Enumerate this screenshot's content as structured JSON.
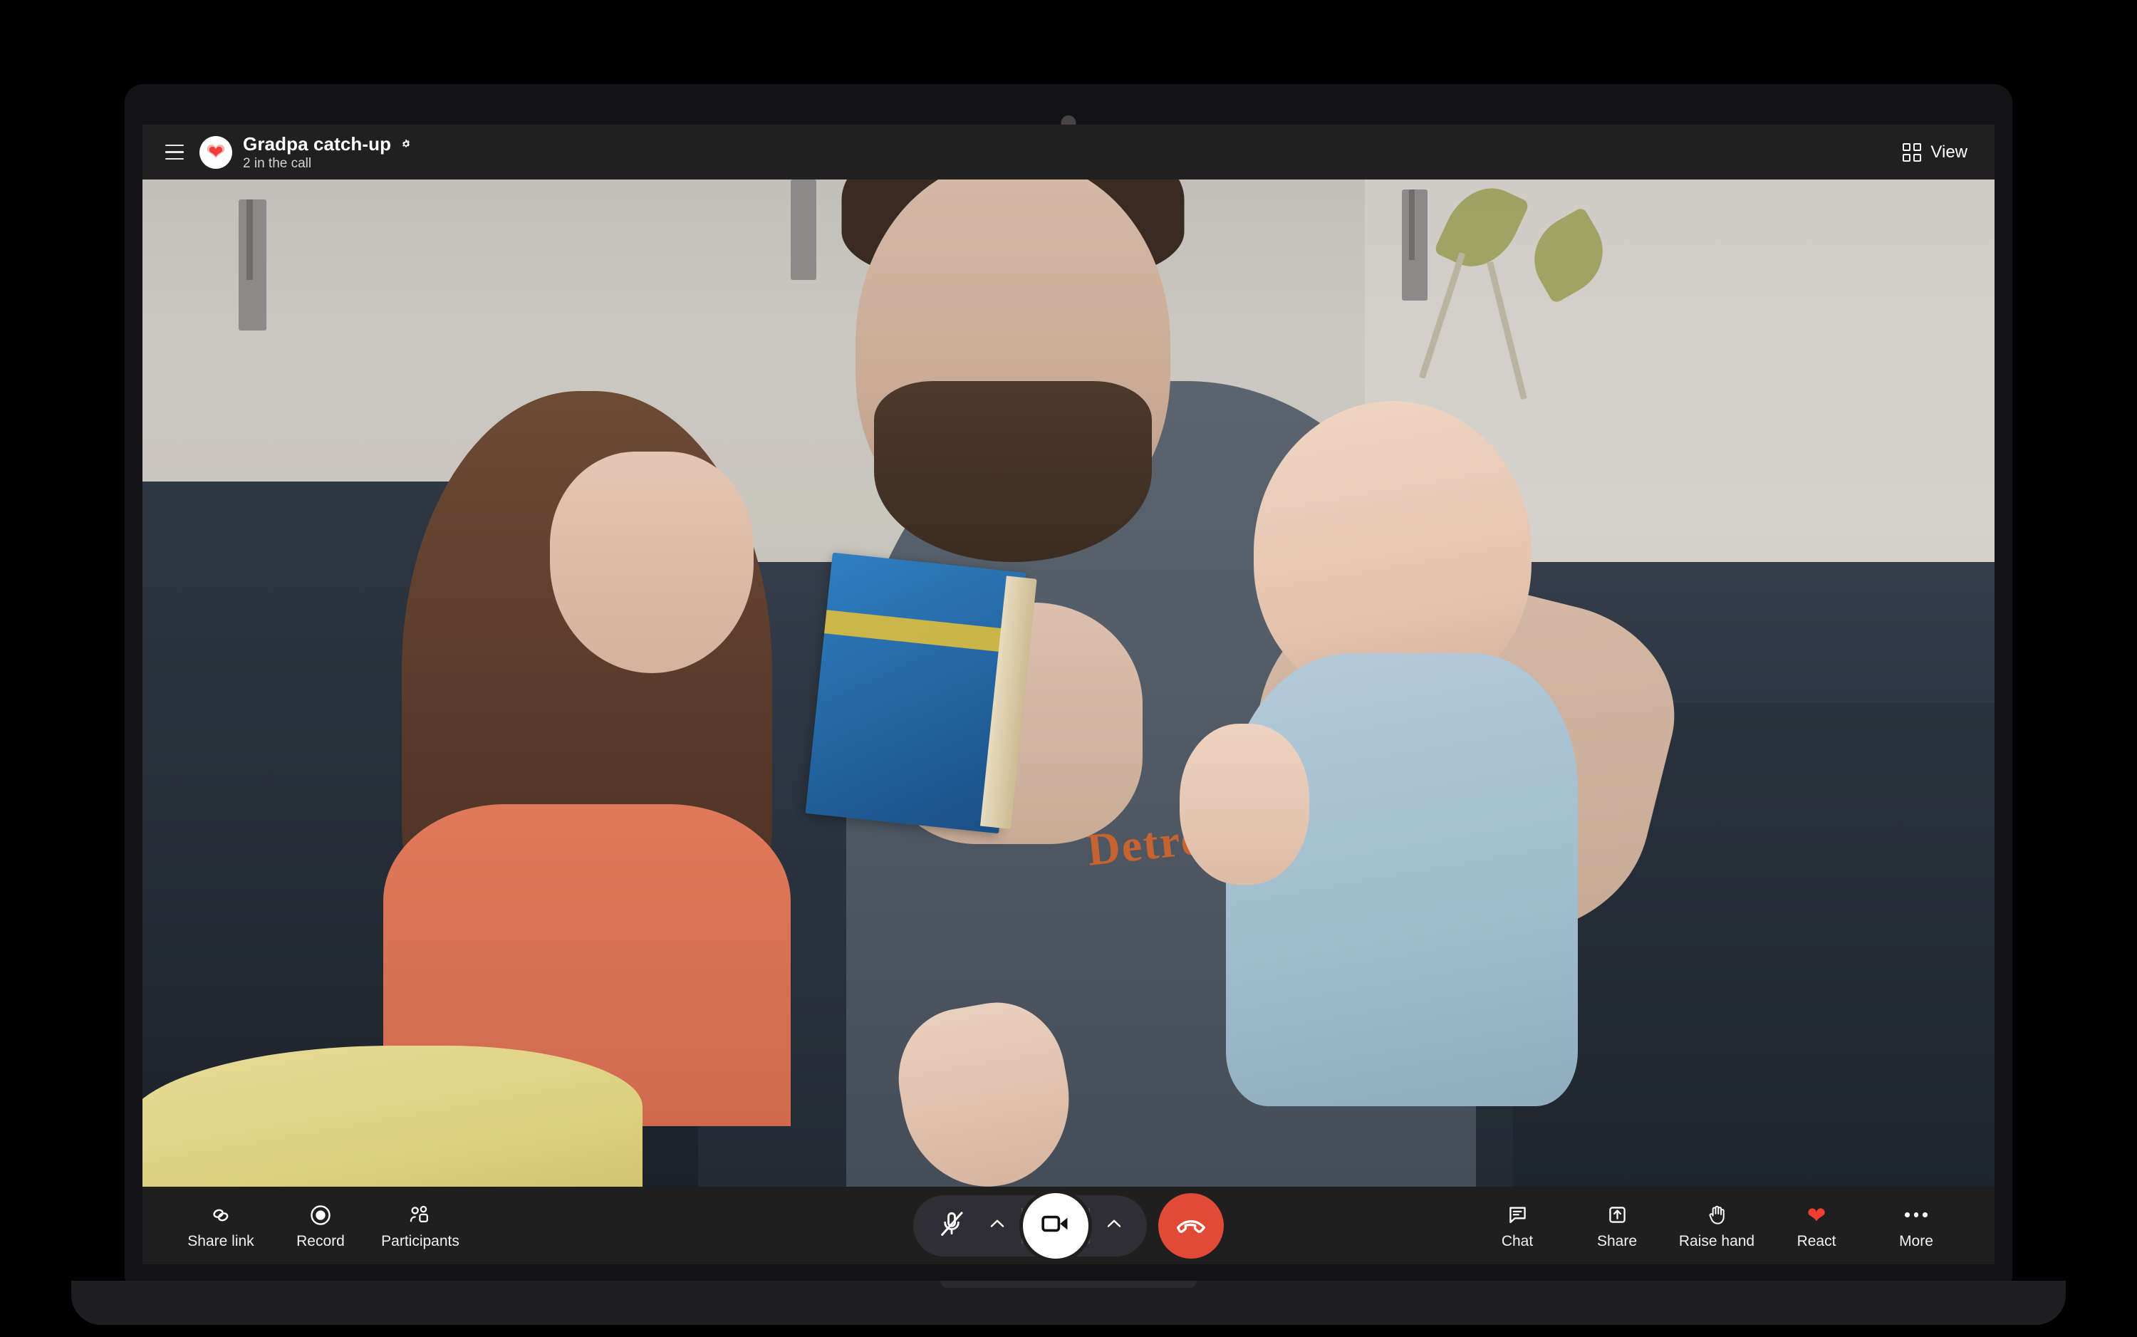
{
  "app": {
    "header": {
      "menu_icon": "hamburger-menu-icon",
      "avatar_icon": "heart-avatar",
      "meeting_title": "Gradpa catch-up",
      "settings_icon": "gear-icon",
      "participant_count": "2 in the call",
      "view_label": "View",
      "view_icon": "grid-view-icon"
    },
    "video": {
      "description": "Live video call feed showing a bearded man on a couch reading a book with a young girl and holding a baby",
      "shirt_text": "Detroit"
    },
    "toolbar": {
      "left_items": [
        {
          "label": "Share link",
          "icon": "link-icon"
        },
        {
          "label": "Record",
          "icon": "record-icon"
        },
        {
          "label": "Participants",
          "icon": "participants-icon"
        }
      ],
      "center": {
        "mic": {
          "icon": "microphone-muted-icon",
          "state": "muted"
        },
        "mic_chevron": {
          "icon": "chevron-up-icon"
        },
        "camera": {
          "icon": "camera-icon",
          "state": "on"
        },
        "camera_chevron": {
          "icon": "chevron-up-icon"
        },
        "hangup": {
          "icon": "phone-hangup-icon"
        }
      },
      "right_items": [
        {
          "label": "Chat",
          "icon": "chat-bubble-icon"
        },
        {
          "label": "Share",
          "icon": "share-upload-icon"
        },
        {
          "label": "Raise hand",
          "icon": "raised-hand-icon"
        },
        {
          "label": "React",
          "icon": "heart-icon"
        },
        {
          "label": "More",
          "icon": "more-ellipsis-icon"
        }
      ]
    },
    "colors": {
      "toolbar_bg": "#1f1f1f",
      "header_bg": "#202020",
      "accent_red": "#ef3e34",
      "hangup_red": "#e04a36",
      "pill_bg": "#2e2e34"
    }
  }
}
